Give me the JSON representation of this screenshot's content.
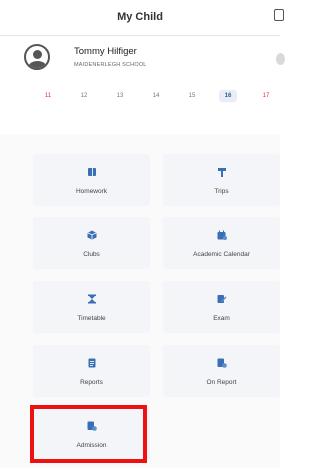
{
  "header": {
    "title": "My Child"
  },
  "profile": {
    "name": "Tommy Hilfiger",
    "school": "MAIDENERLEGH SCHOOL"
  },
  "calendar": {
    "days": [
      {
        "label": "11",
        "color": "red"
      },
      {
        "label": "12",
        "color": "grey"
      },
      {
        "label": "13",
        "color": "grey"
      },
      {
        "label": "14",
        "color": "grey"
      },
      {
        "label": "15",
        "color": "grey"
      },
      {
        "label": "16",
        "color": "selected"
      },
      {
        "label": "17",
        "color": "red"
      }
    ]
  },
  "menu": [
    {
      "label": "Homework",
      "icon": "book-icon"
    },
    {
      "label": "Trips",
      "icon": "signpost-icon"
    },
    {
      "label": "Clubs",
      "icon": "cube-icon"
    },
    {
      "label": "Academic Calendar",
      "icon": "calendar-icon"
    },
    {
      "label": "Timetable",
      "icon": "hourglass-icon"
    },
    {
      "label": "Exam",
      "icon": "exam-edit-icon"
    },
    {
      "label": "Reports",
      "icon": "report-document-icon"
    },
    {
      "label": "On Report",
      "icon": "on-report-icon"
    },
    {
      "label": "Admission",
      "icon": "admission-icon"
    }
  ],
  "colors": {
    "accent": "#3a6fb5",
    "highlight": "#ee1111",
    "weekend": "#d9363e"
  }
}
